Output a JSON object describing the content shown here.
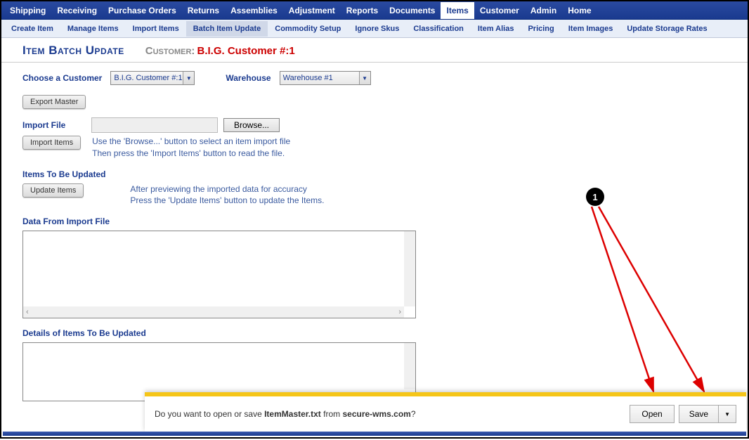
{
  "topnav": {
    "items": [
      {
        "label": "Shipping"
      },
      {
        "label": "Receiving"
      },
      {
        "label": "Purchase Orders"
      },
      {
        "label": "Returns"
      },
      {
        "label": "Assemblies"
      },
      {
        "label": "Adjustment"
      },
      {
        "label": "Reports"
      },
      {
        "label": "Documents"
      },
      {
        "label": "Items",
        "active": true
      },
      {
        "label": "Customer"
      },
      {
        "label": "Admin"
      },
      {
        "label": "Home"
      }
    ]
  },
  "subnav": {
    "items": [
      {
        "label": "Create Item"
      },
      {
        "label": "Manage Items"
      },
      {
        "label": "Import Items"
      },
      {
        "label": "Batch Item Update",
        "active": true
      },
      {
        "label": "Commodity Setup"
      },
      {
        "label": "Ignore Skus"
      },
      {
        "label": "Classification"
      },
      {
        "label": "Item Alias"
      },
      {
        "label": "Pricing"
      },
      {
        "label": "Item Images"
      },
      {
        "label": "Update Storage Rates"
      }
    ]
  },
  "header": {
    "title": "Item Batch Update",
    "customer_label": "Customer:",
    "customer_value": "B.I.G. Customer #:1"
  },
  "form": {
    "choose_customer_label": "Choose a Customer",
    "choose_customer_value": "B.I.G. Customer #:1",
    "warehouse_label": "Warehouse",
    "warehouse_value": "Warehouse #1",
    "export_master_btn": "Export Master",
    "import_file_label": "Import File",
    "browse_btn": "Browse...",
    "import_items_btn": "Import Items",
    "import_help_1": "Use the 'Browse...' button to select an item import file",
    "import_help_2": "Then press the 'Import Items' button to read the file.",
    "items_to_update_label": "Items To Be Updated",
    "update_items_btn": "Update Items",
    "update_help_1": "After previewing the imported data for accuracy",
    "update_help_2": "Press the 'Update Items' button to update the Items.",
    "data_from_file_label": "Data From Import File",
    "details_label": "Details of Items To Be Updated"
  },
  "download_bar": {
    "prefix": "Do you want to open or save ",
    "filename": "ItemMaster.txt",
    "mid": " from ",
    "domain": "secure-wms.com",
    "suffix": "?",
    "open_btn": "Open",
    "save_btn": "Save"
  },
  "callout": {
    "num": "1"
  }
}
